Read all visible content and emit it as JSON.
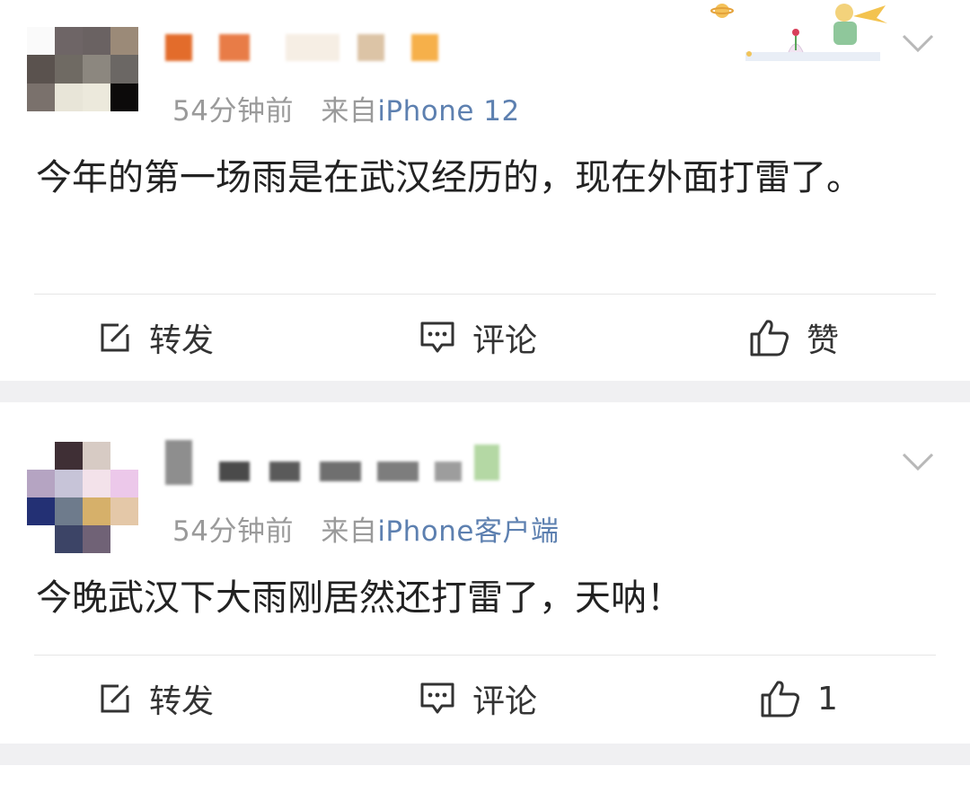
{
  "posts": [
    {
      "meta_time": "54分钟前",
      "meta_from": "来自",
      "meta_source": "iPhone 12",
      "content": "今年的第一场雨是在武汉经历的，现在外面打雷了。",
      "actions": {
        "repost": "转发",
        "comment": "评论",
        "like": "赞"
      }
    },
    {
      "meta_time": "54分钟前",
      "meta_from": "来自",
      "meta_source": "iPhone客户端",
      "content": "今晚武汉下大雨刚居然还打雷了，天呐！",
      "actions": {
        "repost": "转发",
        "comment": "评论",
        "like": "1"
      }
    }
  ],
  "icons": {
    "repost": "edit-square-icon",
    "comment": "comment-bubble-icon",
    "like": "thumbs-up-icon",
    "menu": "chevron-down-icon"
  },
  "colors": {
    "source_link": "#5d80b0",
    "meta_gray": "#9a9a9a",
    "separator": "#f0f0f2"
  }
}
